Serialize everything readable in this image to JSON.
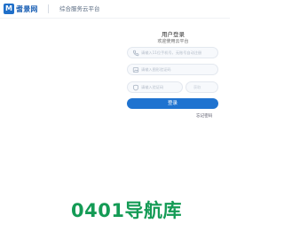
{
  "header": {
    "logo_mark": "M",
    "logo_text": "耆景网",
    "platform_name": "综合服务云平台"
  },
  "login": {
    "title": "用户登录",
    "subtitle": "欢迎使用云平台",
    "phone_placeholder": "请输入11位手机号，无账号自动注册",
    "image_code_placeholder": "请输入图形验证码",
    "sms_code_placeholder": "请输入验证码",
    "send_label": "获取",
    "login_button": "登录",
    "forgot_password": "忘记密码"
  },
  "footer": {
    "watermark": "0401导航库"
  },
  "colors": {
    "brand_blue": "#1f73d0",
    "watermark_green": "#149b55"
  }
}
